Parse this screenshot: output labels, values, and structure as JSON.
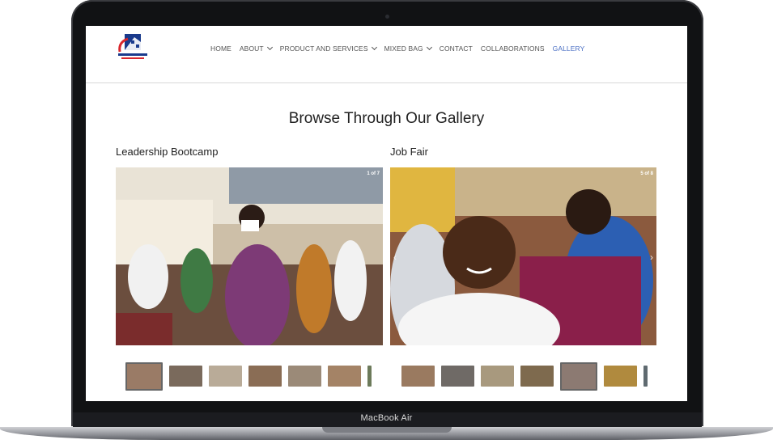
{
  "device": {
    "label": "MacBook Air"
  },
  "nav": {
    "items": [
      {
        "label": "HOME",
        "has_dropdown": false
      },
      {
        "label": "ABOUT",
        "has_dropdown": true
      },
      {
        "label": "PRODUCT AND SERVICES",
        "has_dropdown": true
      },
      {
        "label": "MIXED BAG",
        "has_dropdown": true
      },
      {
        "label": "CONTACT",
        "has_dropdown": false
      },
      {
        "label": "COLLABORATIONS",
        "has_dropdown": false
      },
      {
        "label": "GALLERY",
        "has_dropdown": false,
        "active": true
      }
    ],
    "active_color": "#4a6fc4"
  },
  "page": {
    "title": "Browse Through Our Gallery"
  },
  "galleries": [
    {
      "title": "Leadership Bootcamp",
      "counter": "1 of 7",
      "thumb_count": 7
    },
    {
      "title": "Job Fair",
      "counter": "5 of 8",
      "thumb_count": 7
    }
  ]
}
